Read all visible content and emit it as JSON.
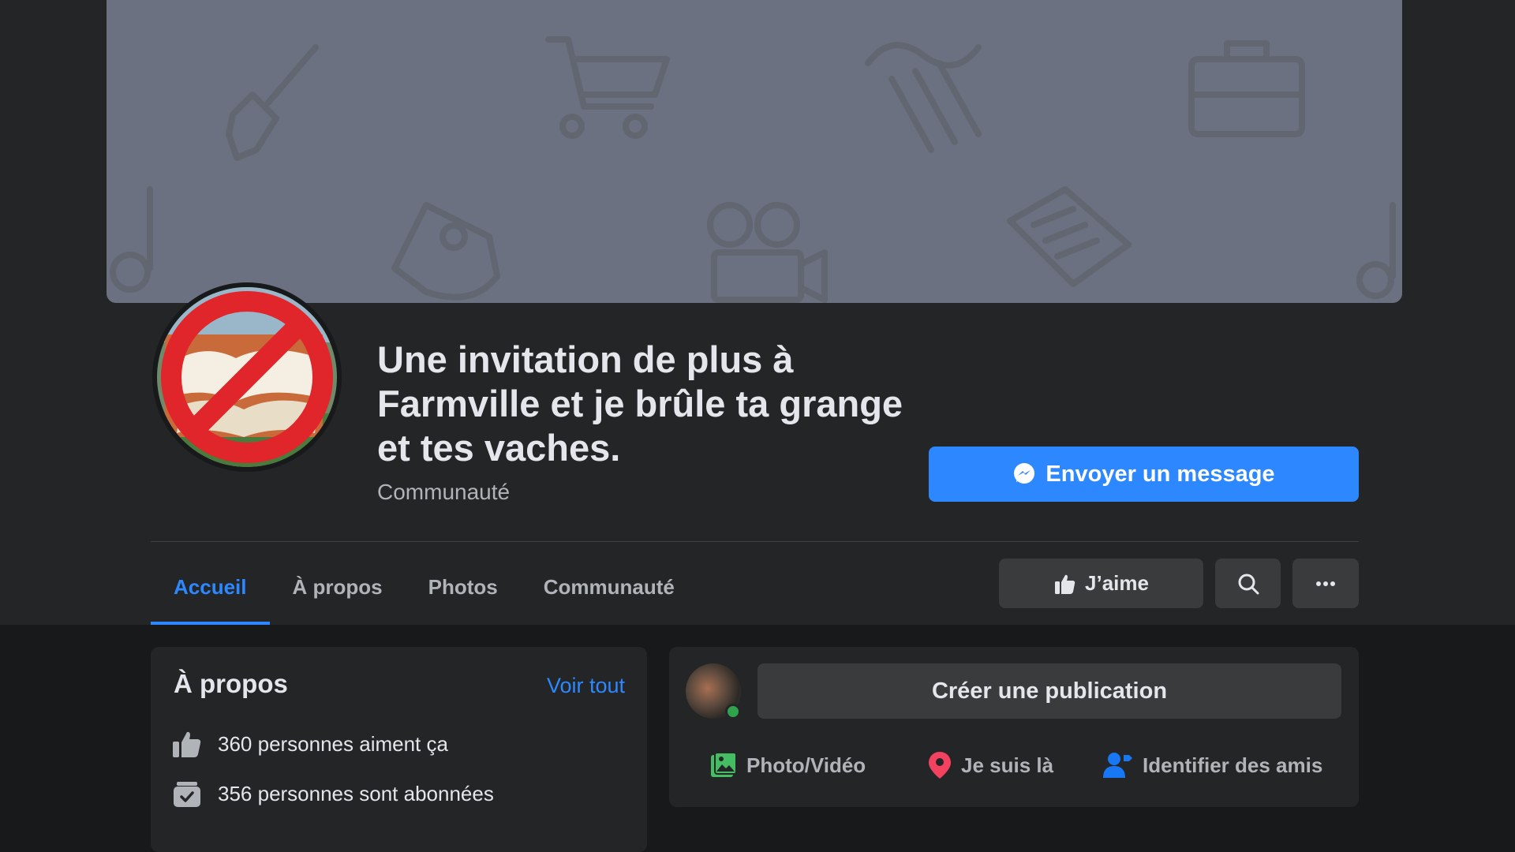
{
  "page": {
    "title": "Une invitation de plus à Farmville et je brûle ta grange et tes vaches.",
    "category": "Communauté",
    "message_button": "Envoyer un message"
  },
  "tabs": [
    {
      "label": "Accueil",
      "active": true
    },
    {
      "label": "À propos",
      "active": false
    },
    {
      "label": "Photos",
      "active": false
    },
    {
      "label": "Communauté",
      "active": false
    }
  ],
  "actions": {
    "like_label": "J’aime"
  },
  "about": {
    "title": "À propos",
    "see_all": "Voir tout",
    "likes": "360 personnes aiment ça",
    "followers": "356 personnes sont abonnées"
  },
  "composer": {
    "create_label": "Créer une publication",
    "photo_video": "Photo/Vidéo",
    "checkin": "Je suis là",
    "tag_friends": "Identifier des amis"
  },
  "colors": {
    "accent": "#2d88ff",
    "background": "#18191a",
    "surface": "#242526",
    "button": "#3a3b3c",
    "photo_icon": "#45bd62",
    "checkin_icon": "#f3425f",
    "tag_icon": "#1877f2",
    "online": "#31a24c"
  },
  "icons": {
    "cover": [
      "paintbrush-icon",
      "shopping-cart-icon",
      "column-icon",
      "briefcase-icon",
      "music-note-icon",
      "car-icon",
      "film-camera-icon",
      "book-icon"
    ],
    "message": "messenger-icon",
    "like": "thumbs-up-icon",
    "search": "search-icon",
    "more": "more-icon"
  }
}
